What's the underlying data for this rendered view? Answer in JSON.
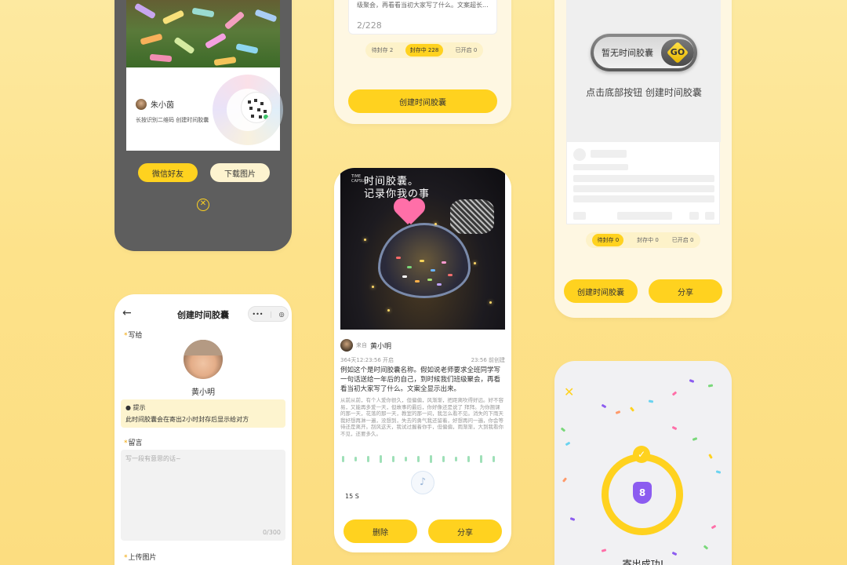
{
  "colors": {
    "accent": "#ffd21f",
    "accent_soft": "#fdf2c9",
    "dark_phone": "#5e5e5e",
    "purple": "#8c5cf0"
  },
  "share_screen": {
    "author": "朱小茵",
    "hint": "长按识别二维码 创建时间胶囊",
    "wechat_button": "微信好友",
    "download_button": "下载图片",
    "close_icon": "close-circle-icon"
  },
  "list_screen_top": {
    "snippet": "级聚会，再看看当初大家写了什么。文案超长...",
    "counter": "2/228",
    "tabs": [
      {
        "label": "待封存 2",
        "active": false
      },
      {
        "label": "封存中 228",
        "active": true
      },
      {
        "label": "已开启 0",
        "active": false
      }
    ],
    "create_button": "创建时间胶囊"
  },
  "empty_screen": {
    "toggle_label": "暂无时间胶囊",
    "go_label": "GO",
    "tip": "点击底部按钮 创建时间胶囊",
    "tabs": [
      {
        "label": "待封存 0",
        "active": true
      },
      {
        "label": "封存中 0",
        "active": false
      },
      {
        "label": "已开启 0",
        "active": false
      }
    ],
    "create_button": "创建时间胶囊",
    "share_button": "分享"
  },
  "create_screen": {
    "title": "创建时间胶囊",
    "back_icon": "back-arrow-icon",
    "capsule_more": "•••",
    "capsule_target": "◎",
    "to_label": "写给",
    "recipient": "黄小明",
    "notice_title": "提示",
    "notice_text": "此时间胶囊会在寄出2小时封存后显示给对方",
    "message_label": "留言",
    "message_placeholder": "写一段有意思的话~",
    "word_count": "0/300",
    "upload_label": "上传图片"
  },
  "detail_screen": {
    "hero_title": "时间胶囊。",
    "hero_subtitle": "记录你我の事",
    "hero_side": "TIME CAPSULE",
    "from_label": "来自",
    "author": "黄小明",
    "meta_left": "364天12:23:56  开启",
    "meta_right": "23:56 前创建",
    "body_main": "例如这个是时间胶囊名称。假如说老师要求全班同学写一句话送给一年后的自己，到时候我们班级聚会，再看看当初大家写了什么。文案全显示出来。",
    "body_secondary": "从前从前，有个人爱你很久，但偏偏，风渐渐，把距离吹得好远。好不容易，又能再多爱一天，但故事的最后，你好像还是说了 拜拜。为你翘课的那一天，花落的那一天，教室的那一间，我怎么看不见。消失的下雨天 我好想再淋一遍，没想到，失去的勇气我还留着，好想再问一遍，你会等待还是离开。刮风这天，我试过握着你手，但偏偏，雨渐渐，大到我看你不见，还要多久。",
    "duration": "15 S",
    "delete_button": "删除",
    "share_button": "分享"
  },
  "success_screen": {
    "close_icon": "close-icon",
    "badge": "8",
    "message": "寄出成功!"
  }
}
